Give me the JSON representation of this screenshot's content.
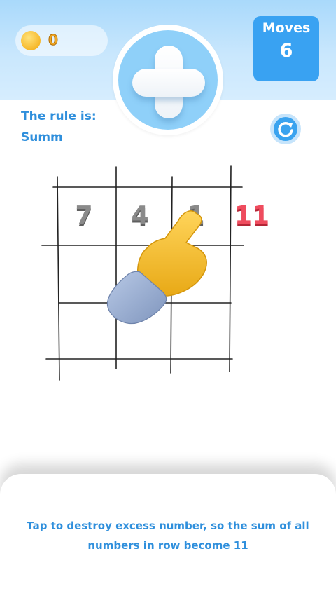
{
  "header": {
    "coin_count": "0",
    "operator_symbol": "plus-icon",
    "moves_label": "Moves",
    "moves_value": "6"
  },
  "rule": {
    "title": "The rule is:",
    "name": "Summ"
  },
  "board": {
    "row1": [
      "7",
      "4",
      "1"
    ],
    "target": "11"
  },
  "hint": {
    "text": "Tap to destroy excess number, so the sum of all numbers in row become 11"
  },
  "colors": {
    "accent": "#2f8fdc",
    "moves_bg": "#39a2f2",
    "target_red": "#ef4c5e",
    "number_gray": "#8a8a8a"
  }
}
